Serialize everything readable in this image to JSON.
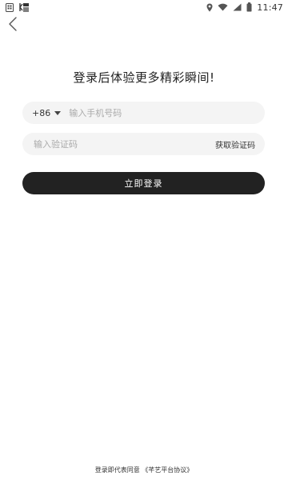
{
  "status_bar": {
    "time": "11:47",
    "left_icons": [
      "sim-card-icon",
      "notification-icon"
    ],
    "right_icons": [
      "location-icon",
      "wifi-icon",
      "signal-icon",
      "battery-icon"
    ]
  },
  "header": {
    "back_icon": "chevron-left-icon"
  },
  "title": "登录后体验更多精彩瞬间!",
  "phone_field": {
    "country_code": "+86",
    "placeholder": "输入手机号码"
  },
  "code_field": {
    "placeholder": "输入验证码",
    "get_code_label": "获取验证码"
  },
  "login_button": {
    "label": "立即登录"
  },
  "agreement": {
    "prefix": "登录即代表同意",
    "link_label": "《芊艺平台协议》"
  },
  "colors": {
    "background": "#ffffff",
    "field_background": "#f4f4f4",
    "primary_button": "#222222",
    "primary_button_text": "#ffffff"
  }
}
